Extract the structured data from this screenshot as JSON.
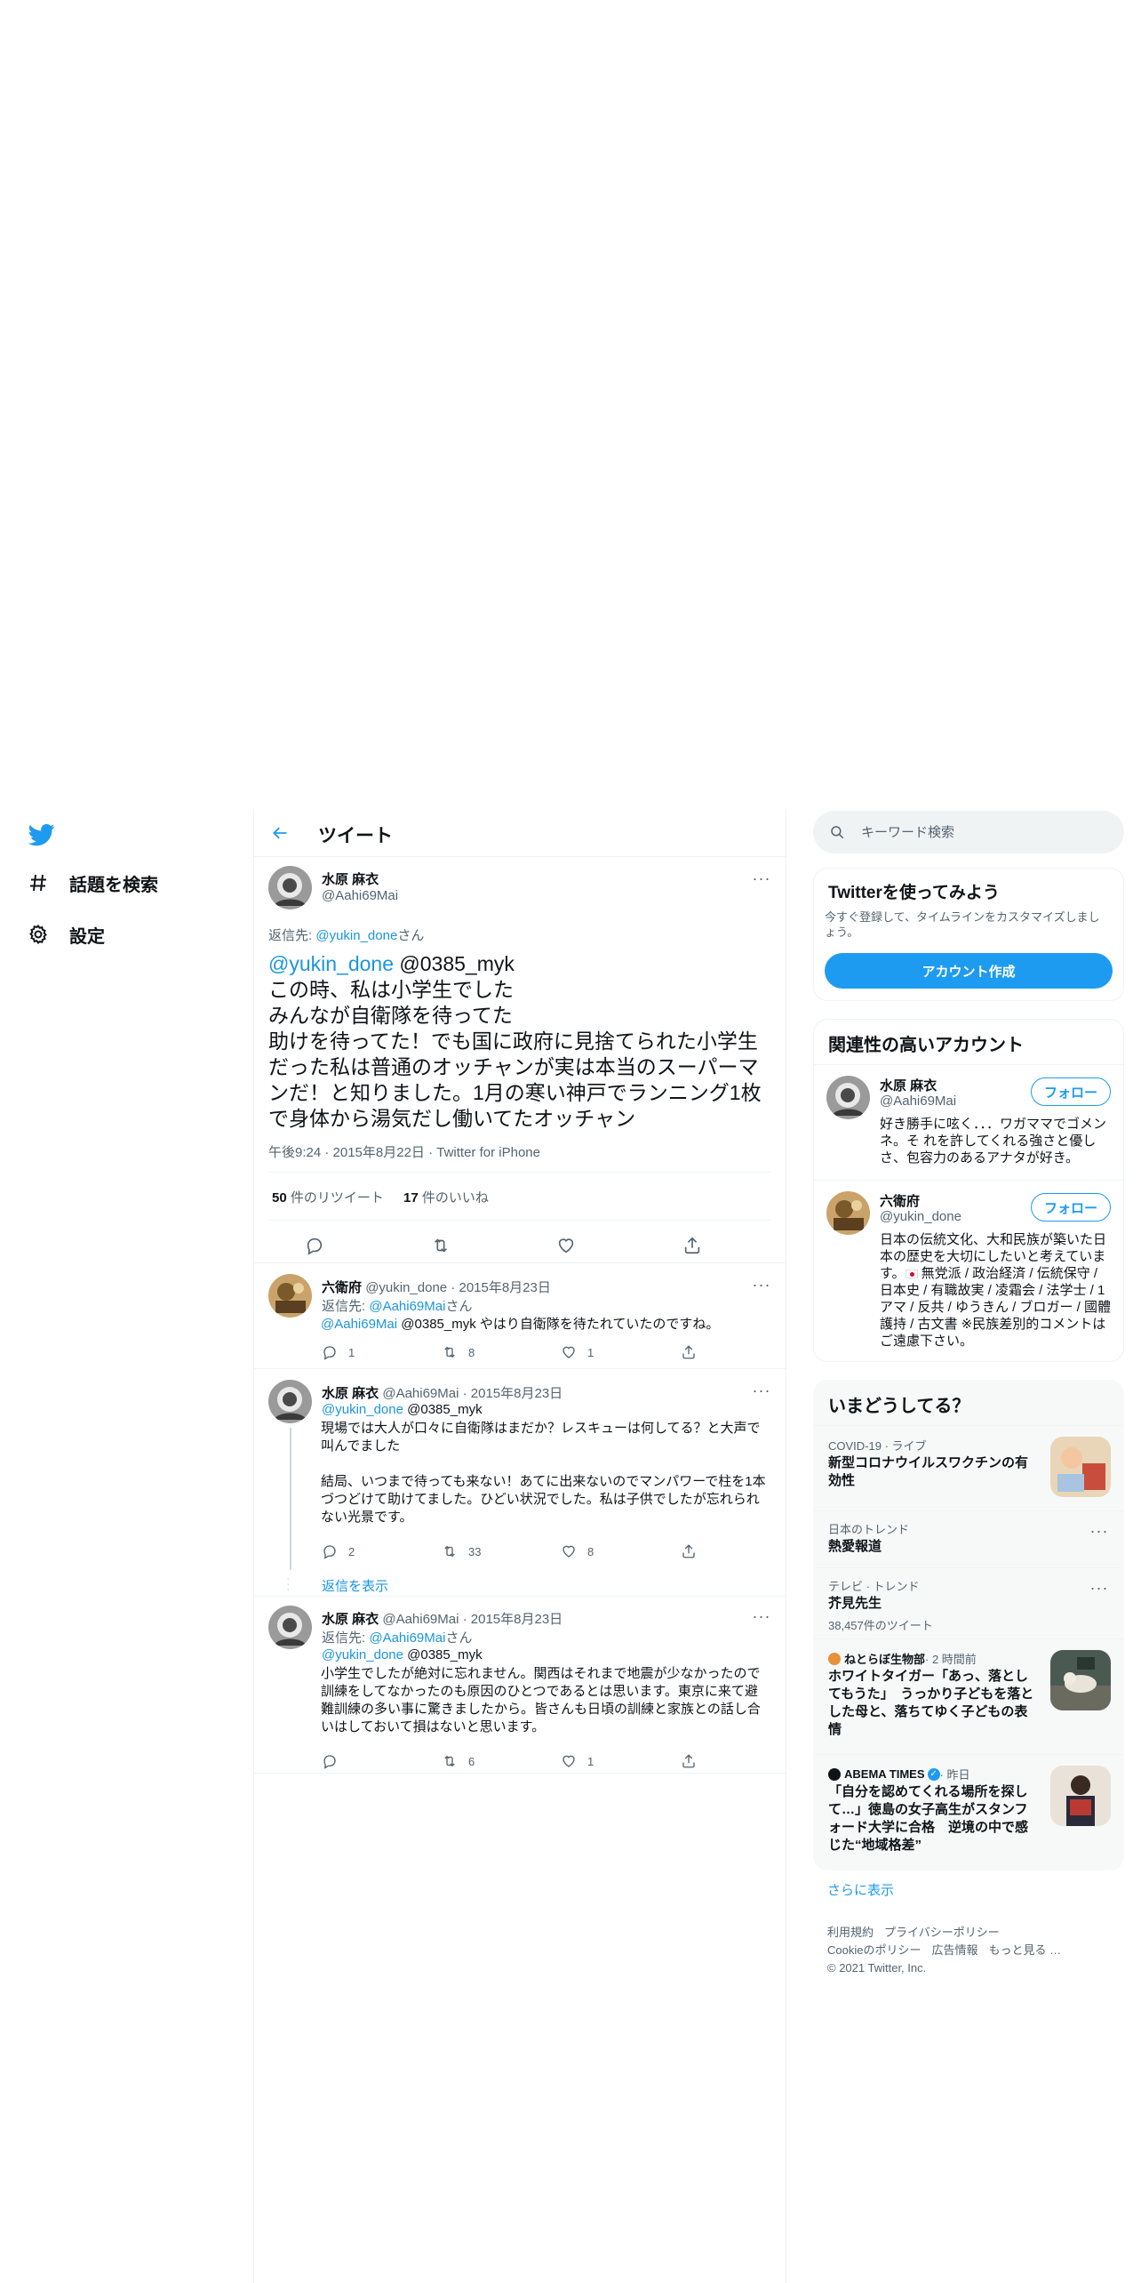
{
  "sidebar": {
    "items": [
      {
        "label": "話題を検索"
      },
      {
        "label": "設定"
      }
    ]
  },
  "header": {
    "title": "ツイート"
  },
  "focus_tweet": {
    "name": "水原 麻衣",
    "handle": "@Aahi69Mai",
    "reply_to_prefix": "返信先: ",
    "reply_to_handle": "@yukin_done",
    "reply_to_suffix": "さん",
    "mention1": "@yukin_done",
    "mention2": " @0385_myk",
    "text": "この時、私は小学生でした\nみんなが自衛隊を待ってた\n助けを待ってた！でも国に政府に見捨てられた小学生だった私は普通のオッチャンが実は本当のスーパーマンだ！と知りました。1月の寒い神戸でランニング1枚で身体から湯気だし働いてたオッチャン",
    "meta": "午後9:24 · 2015年8月22日 · Twitter for iPhone",
    "retweets": "50",
    "retweets_label": " 件のリツイート",
    "likes": "17",
    "likes_label": " 件のいいね"
  },
  "replies": [
    {
      "name": "六衛府",
      "handle_date": "@yukin_done · 2015年8月23日",
      "reply_to_prefix": "返信先: ",
      "reply_to_handle": "@Aahi69Mai",
      "reply_to_suffix": "さん",
      "mention": "@Aahi69Mai",
      "text": " @0385_myk やはり自衛隊を待たれていたのですね。",
      "reply_count": "1",
      "retweet_count": "8",
      "like_count": "1"
    },
    {
      "name": "水原 麻衣",
      "handle_date": "@Aahi69Mai · 2015年8月23日",
      "mention": "@yukin_done",
      "text_after_mention": " @0385_myk",
      "text": "現場では大人が口々に自衛隊はまだか？レスキューは何してる？と大声で叫んでました\n\n結局、いつまで待っても来ない！あてに出来ないのでマンパワーで柱を1本づつどけて助けてました。ひどい状況でした。私は子供でしたが忘れられない光景です。",
      "reply_count": "2",
      "retweet_count": "33",
      "like_count": "8",
      "show_replies": "返信を表示"
    },
    {
      "name": "水原 麻衣",
      "handle_date": "@Aahi69Mai · 2015年8月23日",
      "reply_to_prefix": "返信先: ",
      "reply_to_handle": "@Aahi69Mai",
      "reply_to_suffix": "さん",
      "mention": "@yukin_done",
      "text_after_mention": " @0385_myk",
      "text": "小学生でしたが絶対に忘れません。関西はそれまで地震が少なかったので訓練をしてなかったのも原因のひとつであるとは思います。東京に来て避難訓練の多い事に驚きましたから。皆さんも日頃の訓練と家族との話し合いはしておいて損はないと思います。",
      "retweet_count": "6",
      "like_count": "1"
    }
  ],
  "search": {
    "placeholder": "キーワード検索"
  },
  "signup": {
    "title": "Twitterを使ってみよう",
    "desc": "今すぐ登録して、タイムラインをカスタマイズしましょう。",
    "button": "アカウント作成"
  },
  "related": {
    "title": "関連性の高いアカウント",
    "follow_label": "フォロー",
    "accounts": [
      {
        "name": "水原 麻衣",
        "handle": "@Aahi69Mai",
        "bio": "好き勝手に呟く．．．ワガママでゴメンネ。そ れを許してくれる強さと優しさ、包容力のあるアナタが好き。"
      },
      {
        "name": "六衛府",
        "handle": "@yukin_done",
        "bio_before_flag": "日本の伝統文化、大和民族が築いた日本の歴史を大切にしたいと考えています。",
        "bio_after_flag": " 無党派 / 政治経済 / 伝統保守 / 日本史 / 有職故実 / 凌霜会 / 法学士 / 1アマ / 反共 / ゆうきん / ブロガー / 國體護持 / 古文書 ※民族差別的コメントはご遠慮下さい。"
      }
    ]
  },
  "trends": {
    "title": "いまどうしてる？",
    "items": [
      {
        "meta": "COVID-19 · ライブ",
        "title": "新型コロナウイルスワクチンの有効性"
      },
      {
        "meta": "日本のトレンド",
        "title": "熱愛報道"
      },
      {
        "meta": "テレビ · トレンド",
        "title": "芥見先生",
        "sub": "38,457件のツイート"
      },
      {
        "source": "ねとらぼ生物部",
        "time": " · 2 時間前",
        "title": "ホワイトタイガー「あっ、落としてもうた」　うっかり子どもを落とした母と、落ちてゆく子どもの表情"
      },
      {
        "source": "ABEMA TIMES",
        "time": " · 昨日",
        "title": "「自分を認めてくれる場所を探して…」徳島の女子高生がスタンフォード大学に合格　逆境の中で感じた“地域格差”"
      }
    ],
    "show_more": "さらに表示"
  },
  "footer": {
    "links_row1": [
      "利用規約",
      "プライバシーポリシー"
    ],
    "links_row2": [
      "Cookieのポリシー",
      "広告情報",
      "もっと見る …"
    ],
    "copyright": "© 2021 Twitter, Inc."
  },
  "colors": {
    "accent": "#1d9bf0",
    "link": "#1b95e0",
    "text": "#0f1419",
    "secondary": "#536471",
    "border": "#eff3f4"
  }
}
